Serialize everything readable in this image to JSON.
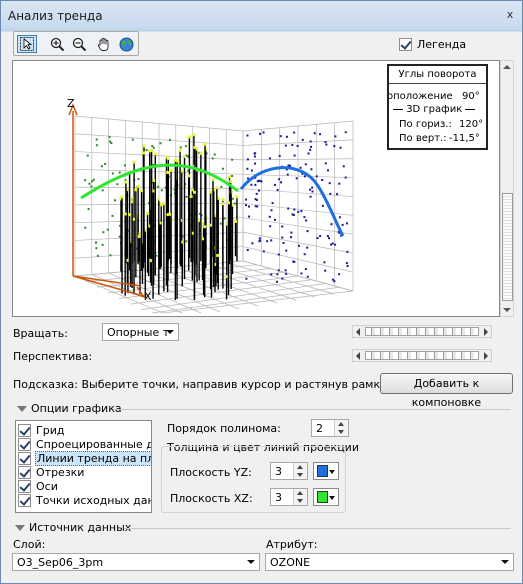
{
  "window": {
    "title": "Анализ тренда",
    "close_glyph": "x"
  },
  "toolbar": {
    "tools": [
      {
        "name": "select-tool",
        "icon": "select-arrow-icon"
      },
      {
        "name": "zoom-in-tool",
        "icon": "zoom-in-icon"
      },
      {
        "name": "zoom-out-tool",
        "icon": "zoom-out-icon"
      },
      {
        "name": "pan-tool",
        "icon": "hand-icon"
      },
      {
        "name": "full-extent-tool",
        "icon": "globe-icon"
      }
    ]
  },
  "legend_checkbox": {
    "label": "Легенда",
    "checked": true
  },
  "plot": {
    "axis_z": "Z",
    "axis_x": "X",
    "colors": {
      "xz_trend": "#2ee62e",
      "yz_trend": "#1f6fe0",
      "points_xz": "#2a8a2a",
      "points_yz": "#1a1a9a",
      "sticks": "#000000",
      "stick_tips": "#e6f23a",
      "axis": "#cc5511"
    }
  },
  "rotation_box": {
    "title": "Углы поворота",
    "position_label": "оположение",
    "position_value": "90°",
    "section": "3D график",
    "horiz_label": "По гориз.:",
    "horiz_value": "120°",
    "vert_label": "По верт.:",
    "vert_value": "-11,5°"
  },
  "rotate": {
    "label": "Вращать:",
    "value": "Опорные т"
  },
  "perspective": {
    "label": "Перспектива:"
  },
  "hint": {
    "text": "Подсказка: Выберите точки, направив курсор и растянув рамку"
  },
  "add_to_layout_button": "Добавить к компоновке",
  "graph_options": {
    "title": "Опции графика",
    "items": [
      {
        "label": "Грид",
        "checked": true
      },
      {
        "label": "Спроецированные дан",
        "checked": true
      },
      {
        "label": "Линии тренда на плоск",
        "checked": true
      },
      {
        "label": "Отрезки",
        "checked": true
      },
      {
        "label": "Оси",
        "checked": true
      },
      {
        "label": "Точки исходных данны",
        "checked": true
      }
    ],
    "polynomial_order_label": "Порядок полинома:",
    "polynomial_order_value": "2",
    "projection_title": "Толщина и цвет линий проекции",
    "yz_label": "Плоскость YZ:",
    "yz_value": "3",
    "yz_color": "#1f6fe0",
    "xz_label": "Плоскость XZ:",
    "xz_value": "3",
    "xz_color": "#2ee62e"
  },
  "data_source": {
    "title": "Источник данных",
    "layer_label": "Слой:",
    "layer_value": "O3_Sep06_3pm",
    "attribute_label": "Атрибут:",
    "attribute_value": "OZONE"
  }
}
